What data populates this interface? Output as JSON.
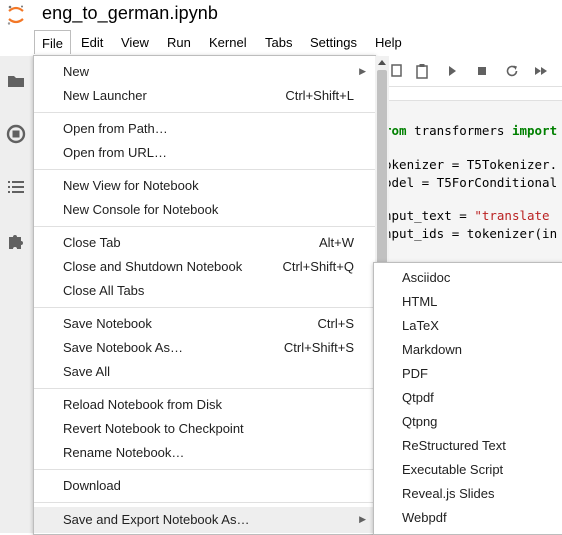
{
  "window": {
    "title": "eng_to_german.ipynb"
  },
  "menubar": [
    "File",
    "Edit",
    "View",
    "Run",
    "Kernel",
    "Tabs",
    "Settings",
    "Help"
  ],
  "sidebar_icons": [
    "folder-icon",
    "running-icon",
    "toc-icon",
    "extension-icon"
  ],
  "toolbar_icons": [
    "copy-icon",
    "paste-icon",
    "run-icon",
    "stop-icon",
    "restart-icon",
    "fast-forward-icon"
  ],
  "code": {
    "line1_kw": "rom",
    "line1_mid": " transformers ",
    "line1_kw2": "import",
    "line2": "okenizer = T5Tokenizer.",
    "line3": "odel = T5ForConditional",
    "line4_pre": "nput_text = ",
    "line4_str": "\"translate",
    "line5": "nput_ids = tokenizer(in"
  },
  "file_menu": {
    "new": "New",
    "new_launcher": "New Launcher",
    "new_launcher_sc": "Ctrl+Shift+L",
    "open_from_path": "Open from Path…",
    "open_from_url": "Open from URL…",
    "new_view": "New View for Notebook",
    "new_console": "New Console for Notebook",
    "close_tab": "Close Tab",
    "close_tab_sc": "Alt+W",
    "close_shutdown": "Close and Shutdown Notebook",
    "close_shutdown_sc": "Ctrl+Shift+Q",
    "close_all": "Close All Tabs",
    "save": "Save Notebook",
    "save_sc": "Ctrl+S",
    "save_as": "Save Notebook As…",
    "save_as_sc": "Ctrl+Shift+S",
    "save_all": "Save All",
    "reload": "Reload Notebook from Disk",
    "revert": "Revert Notebook to Checkpoint",
    "rename": "Rename Notebook…",
    "download": "Download",
    "export": "Save and Export Notebook As…"
  },
  "export_submenu": [
    "Asciidoc",
    "HTML",
    "LaTeX",
    "Markdown",
    "PDF",
    "Qtpdf",
    "Qtpng",
    "ReStructured Text",
    "Executable Script",
    "Reveal.js Slides",
    "Webpdf"
  ],
  "colors": {
    "accent": "#f37726",
    "hover": "#eeeeee",
    "keyword": "#008000",
    "string": "#ba2121"
  }
}
